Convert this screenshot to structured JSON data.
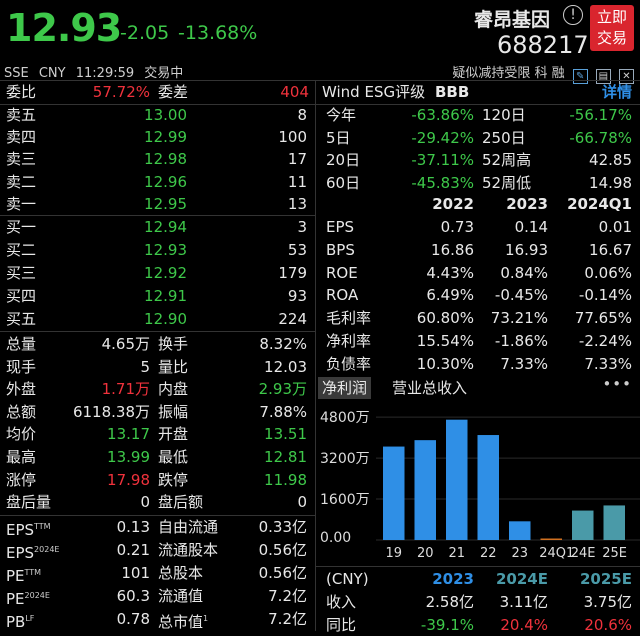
{
  "header": {
    "price": "12.93",
    "change": "-2.05",
    "change_pct": "-13.68%",
    "name": "睿昂基因",
    "code": "688217",
    "trade_button": [
      "立即",
      "交易"
    ],
    "exchange": "SSE",
    "currency": "CNY",
    "time": "11:29:59",
    "status": "交易中",
    "tags": "疑似减持受限 科 融"
  },
  "orderbook": {
    "ratio_label": "委比",
    "ratio": "57.72%",
    "diff_label": "委差",
    "diff": "404",
    "asks": [
      {
        "label": "卖五",
        "price": "13.00",
        "vol": "8"
      },
      {
        "label": "卖四",
        "price": "12.99",
        "vol": "100"
      },
      {
        "label": "卖三",
        "price": "12.98",
        "vol": "17"
      },
      {
        "label": "卖二",
        "price": "12.96",
        "vol": "11"
      },
      {
        "label": "卖一",
        "price": "12.95",
        "vol": "13"
      }
    ],
    "bids": [
      {
        "label": "买一",
        "price": "12.94",
        "vol": "3"
      },
      {
        "label": "买二",
        "price": "12.93",
        "vol": "53"
      },
      {
        "label": "买三",
        "price": "12.92",
        "vol": "179"
      },
      {
        "label": "买四",
        "price": "12.91",
        "vol": "93"
      },
      {
        "label": "买五",
        "price": "12.90",
        "vol": "224"
      }
    ]
  },
  "stats": [
    {
      "l1": "总量",
      "v1": "4.65万",
      "c1": "white",
      "l2": "换手",
      "v2": "8.32%",
      "c2": "white"
    },
    {
      "l1": "现手",
      "v1": "5",
      "c1": "white",
      "l2": "量比",
      "v2": "12.03",
      "c2": "white"
    },
    {
      "l1": "外盘",
      "v1": "1.71万",
      "c1": "red",
      "l2": "内盘",
      "v2": "2.93万",
      "c2": "green"
    },
    {
      "l1": "总额",
      "v1": "6118.38万",
      "c1": "white",
      "l2": "振幅",
      "v2": "7.88%",
      "c2": "white"
    },
    {
      "l1": "均价",
      "v1": "13.17",
      "c1": "green",
      "l2": "开盘",
      "v2": "13.51",
      "c2": "green"
    },
    {
      "l1": "最高",
      "v1": "13.99",
      "c1": "green",
      "l2": "最低",
      "v2": "12.81",
      "c2": "green"
    },
    {
      "l1": "涨停",
      "v1": "17.98",
      "c1": "red",
      "l2": "跌停",
      "v2": "11.98",
      "c2": "green"
    },
    {
      "l1": "盘后量",
      "v1": "0",
      "c1": "white",
      "l2": "盘后额",
      "v2": "0",
      "c2": "white"
    }
  ],
  "valuation": [
    {
      "l1": "EPS",
      "s1": "TTM",
      "v1": "0.13",
      "l2": "自由流通",
      "s2": "",
      "v2": "0.33亿"
    },
    {
      "l1": "EPS",
      "s1": "2024E",
      "v1": "0.21",
      "l2": "流通股本",
      "s2": "",
      "v2": "0.56亿"
    },
    {
      "l1": "PE",
      "s1": "TTM",
      "v1": "101",
      "l2": "总股本",
      "s2": "",
      "v2": "0.56亿"
    },
    {
      "l1": "PE",
      "s1": "2024E",
      "v1": "60.3",
      "l2": "流通值",
      "s2": "",
      "v2": "7.2亿"
    },
    {
      "l1": "PB",
      "s1": "LF",
      "v1": "0.78",
      "l2": "总市值",
      "s2": "1",
      "v2": "7.2亿"
    }
  ],
  "esg": {
    "label": "Wind ESG评级",
    "rating": "BBB",
    "detail": "详情"
  },
  "perf": [
    {
      "l1": "今年",
      "v1": "-63.86%",
      "l2": "120日",
      "v2": "-56.17%"
    },
    {
      "l1": "5日",
      "v1": "-29.42%",
      "l2": "250日",
      "v2": "-66.78%"
    },
    {
      "l1": "20日",
      "v1": "-37.11%",
      "l2": "52周高",
      "v2": "42.85"
    },
    {
      "l1": "60日",
      "v1": "-45.83%",
      "l2": "52周低",
      "v2": "14.98"
    }
  ],
  "fin": {
    "years": [
      "2022",
      "2023",
      "2024Q1"
    ],
    "rows": [
      {
        "label": "EPS",
        "vals": [
          "0.73",
          "0.14",
          "0.01"
        ]
      },
      {
        "label": "BPS",
        "vals": [
          "16.86",
          "16.93",
          "16.67"
        ]
      },
      {
        "label": "ROE",
        "vals": [
          "4.43%",
          "0.84%",
          "0.06%"
        ]
      },
      {
        "label": "ROA",
        "vals": [
          "6.49%",
          "-0.45%",
          "-0.14%"
        ]
      },
      {
        "label": "毛利率",
        "vals": [
          "60.80%",
          "73.21%",
          "77.65%"
        ]
      },
      {
        "label": "净利率",
        "vals": [
          "15.54%",
          "-1.86%",
          "-2.24%"
        ]
      },
      {
        "label": "负债率",
        "vals": [
          "10.30%",
          "7.33%",
          "7.33%"
        ]
      }
    ]
  },
  "tabs": {
    "active": "净利润",
    "other": "营业总收入",
    "more": "•••"
  },
  "chart_data": {
    "type": "bar",
    "categories": [
      "19",
      "20",
      "21",
      "22",
      "23",
      "24Q1",
      "24E",
      "25E"
    ],
    "values": [
      3650,
      3900,
      4700,
      4100,
      730,
      20,
      1150,
      1350
    ],
    "yticks": [
      "4800万",
      "3200万",
      "1600万",
      "0.00"
    ],
    "ylim": [
      0,
      5000
    ],
    "colors": [
      "#2f8fe6",
      "#2f8fe6",
      "#2f8fe6",
      "#2f8fe6",
      "#2f8fe6",
      "#d07020",
      "#4a9aa8",
      "#4a9aa8"
    ]
  },
  "forecast": {
    "unit": "(CNY)",
    "years": [
      "2023",
      "2024E",
      "2025E"
    ],
    "rows": [
      {
        "label": "收入",
        "vals": [
          "2.58亿",
          "3.11亿",
          "3.75亿"
        ]
      },
      {
        "label": "同比",
        "vals": [
          "-39.1%",
          "20.4%",
          "20.6%"
        ]
      }
    ]
  },
  "colors": {
    "up": "#f0323c",
    "down": "#3ec84a",
    "accent": "#2f8fe6",
    "trade": "#d9252e"
  }
}
